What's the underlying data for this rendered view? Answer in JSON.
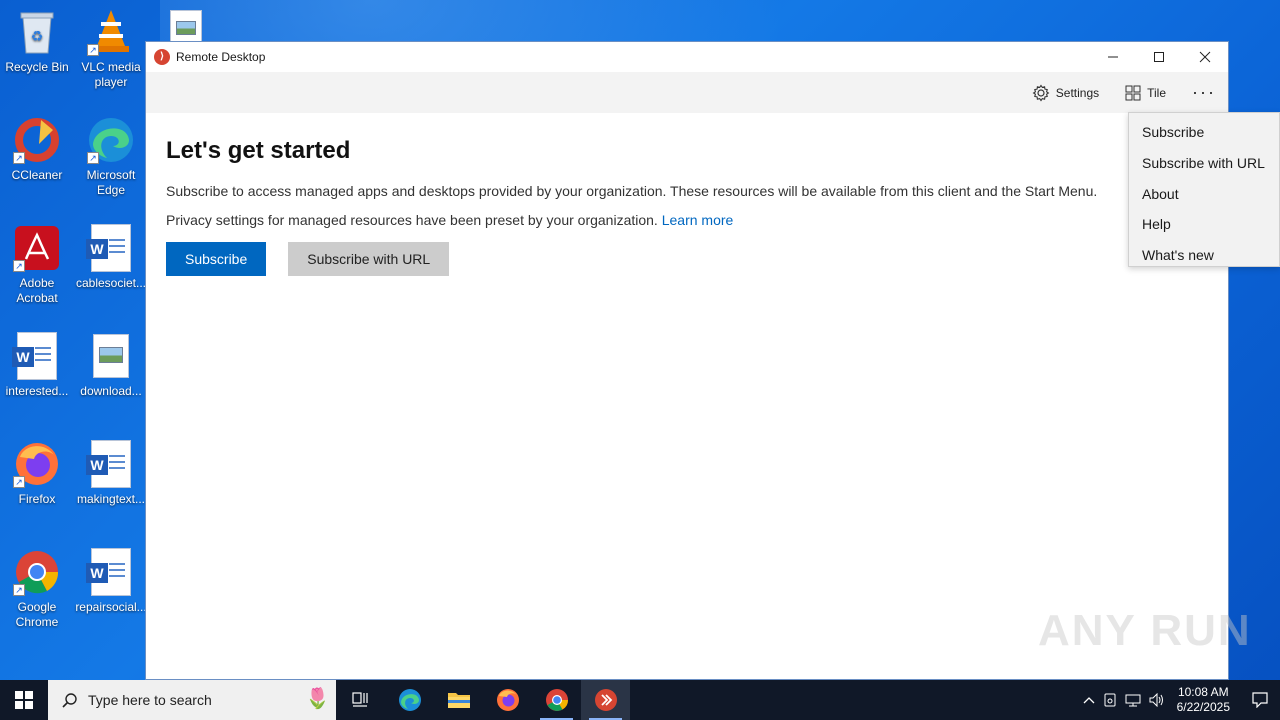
{
  "desktop": {
    "icons": [
      {
        "label": "Recycle Bin"
      },
      {
        "label": "VLC media player"
      },
      {
        "label": "CCleaner"
      },
      {
        "label": "Microsoft Edge"
      },
      {
        "label": "Adobe Acrobat"
      },
      {
        "label": "cablesociet..."
      },
      {
        "label": "interested..."
      },
      {
        "label": "download..."
      },
      {
        "label": "Firefox"
      },
      {
        "label": "makingtext..."
      },
      {
        "label": "Google Chrome"
      },
      {
        "label": "repairsocial..."
      }
    ]
  },
  "window": {
    "title": "Remote Desktop",
    "toolbar": {
      "settings_label": "Settings",
      "tile_label": "Tile",
      "more_label": "···"
    },
    "heading": "Let's get started",
    "paragraph1": "Subscribe to access managed apps and desktops provided by your organization. These resources will be available from this client and the Start Menu.",
    "paragraph2": "Privacy settings for managed resources have been preset by your organization.",
    "learn_more": "Learn more",
    "subscribe_button": "Subscribe",
    "subscribe_url_button": "Subscribe with URL"
  },
  "menu": {
    "items": [
      "Subscribe",
      "Subscribe with URL",
      "About",
      "Help",
      "What's new"
    ]
  },
  "watermark": "ANY RUN",
  "taskbar": {
    "search_placeholder": "Type here to search",
    "time": "10:08 AM",
    "date": "6/22/2025"
  },
  "colors": {
    "accent": "#0067c0",
    "desktop": "#0b63d6",
    "taskbar": "#101828"
  }
}
